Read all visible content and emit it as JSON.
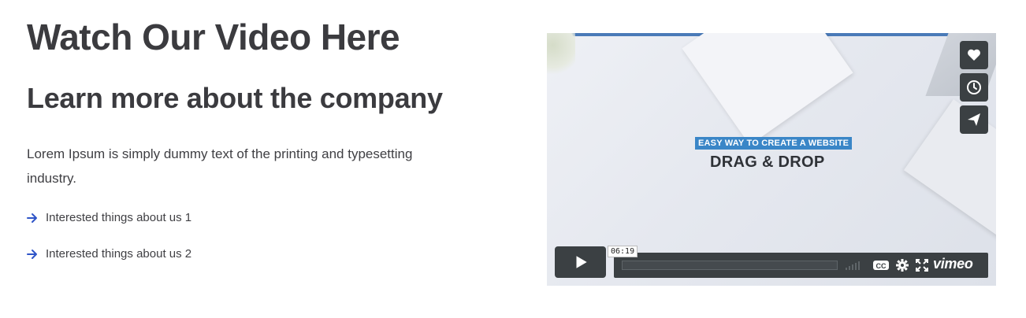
{
  "content": {
    "heading": "Watch Our Video Here",
    "subheading": "Learn more about the company",
    "lead": "Lorem Ipsum is simply dummy text of the printing and typesetting industry.",
    "items": [
      {
        "label": "Interested things about us 1"
      },
      {
        "label": "Interested things about us 2"
      }
    ]
  },
  "video": {
    "tag_line": "EASY WAY TO CREATE A WEBSITE",
    "title": "DRAG & DROP",
    "time": "06:19",
    "brand": "vimeo",
    "side_buttons": [
      "heart-icon",
      "clock-icon",
      "send-icon"
    ],
    "controls": [
      "play-icon",
      "volume-icon",
      "cc-icon",
      "gear-icon",
      "fullscreen-icon"
    ]
  },
  "colors": {
    "arrow": "#2f55c8",
    "player_bar": "#3b4043",
    "tag_background": "#3a86c7",
    "top_border": "#4a7ab8"
  }
}
